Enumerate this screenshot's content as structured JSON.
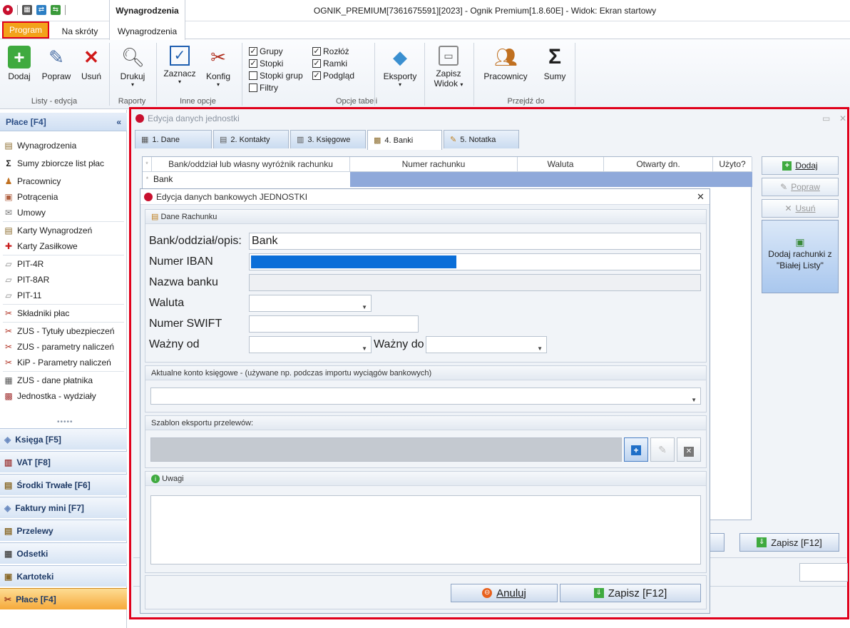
{
  "window": {
    "title": "OGNIK_PREMIUM[7361675591][2023] - Ognik Premium[1.8.60E] - Widok: Ekran startowy",
    "context_tab": "Wynagrodzenia"
  },
  "tabs": {
    "program": "Program",
    "shortcuts": "Na skróty",
    "active": "Wynagrodzenia"
  },
  "ribbon": {
    "lists": {
      "add": "Dodaj",
      "edit": "Popraw",
      "delete": "Usuń",
      "group": "Listy - edycja"
    },
    "reports": {
      "print": "Drukuj",
      "group": "Raporty"
    },
    "other": {
      "select": "Zaznacz",
      "config": "Konfig",
      "group": "Inne opcje"
    },
    "options": {
      "items": [
        {
          "label": "Grupy",
          "checked": true
        },
        {
          "label": "Stopki",
          "checked": true
        },
        {
          "label": "Stopki grup",
          "checked": false
        },
        {
          "label": "Filtry",
          "checked": false
        },
        {
          "label": "Rozłóż",
          "checked": true
        },
        {
          "label": "Ramki",
          "checked": true
        },
        {
          "label": "Podgląd",
          "checked": true
        }
      ],
      "group": "Opcje tabeli"
    },
    "export": {
      "exports": "Eksporty",
      "save_view_1": "Zapisz",
      "save_view_2": "Widok"
    },
    "goto": {
      "employees": "Pracownicy",
      "sums": "Sumy",
      "group": "Przejdź do"
    }
  },
  "sidebar": {
    "header": "Płace [F4]",
    "items": [
      {
        "label": "Wynagrodzenia"
      },
      {
        "label": "Sumy zbiorcze list płac"
      },
      {
        "label": "Pracownicy"
      },
      {
        "label": "Potrącenia"
      },
      {
        "label": "Umowy"
      },
      {
        "label": "Karty Wynagrodzeń"
      },
      {
        "label": "Karty Zasiłkowe"
      },
      {
        "label": "PIT-4R"
      },
      {
        "label": "PIT-8AR"
      },
      {
        "label": "PIT-11"
      },
      {
        "label": "Składniki płac"
      },
      {
        "label": "ZUS - Tytuły ubezpieczeń"
      },
      {
        "label": "ZUS - parametry naliczeń"
      },
      {
        "label": "KiP - Parametry naliczeń"
      },
      {
        "label": "ZUS - dane płatnika"
      },
      {
        "label": "Jednostka - wydziały"
      }
    ],
    "modules": [
      {
        "label": "Księga [F5]"
      },
      {
        "label": "VAT [F8]"
      },
      {
        "label": "Środki Trwałe [F6]"
      },
      {
        "label": "Faktury mini [F7]"
      },
      {
        "label": "Przelewy"
      },
      {
        "label": "Odsetki"
      },
      {
        "label": "Kartoteki"
      },
      {
        "label": "Płace [F4]"
      }
    ]
  },
  "unit_window": {
    "title": "Edycja danych jednostki",
    "tabs": [
      "1. Dane",
      "2. Kontakty",
      "3. Księgowe",
      "4. Banki",
      "5. Notatka"
    ],
    "grid": {
      "columns": [
        "Bank/oddział lub własny wyróżnik rachunku",
        "Numer rachunku",
        "Waluta",
        "Otwarty dn.",
        "Użyto?"
      ],
      "row": "Bank"
    },
    "buttons": {
      "add": "Dodaj",
      "edit": "Popraw",
      "delete": "Usuń",
      "white_list": "Dodaj rachunki z \"Białej Listy\"",
      "save": "Zapisz [F12]"
    }
  },
  "bank_dialog": {
    "title": "Edycja danych bankowych JEDNOSTKI",
    "section_account": "Dane Rachunku",
    "labels": {
      "bank": "Bank/oddział/opis:",
      "iban": "Numer IBAN",
      "bank_name": "Nazwa banku",
      "currency": "Waluta",
      "swift": "Numer SWIFT",
      "valid_from": "Ważny od",
      "valid_to": "Ważny do"
    },
    "values": {
      "bank": "Bank",
      "iban": "",
      "bank_name": "",
      "currency": "",
      "swift": "",
      "valid_from": "",
      "valid_to": ""
    },
    "section_ledger": "Aktualne konto księgowe - (używane np. podczas importu wyciągów bankowych)",
    "section_template": "Szablon eksportu przelewów:",
    "section_notes": "Uwagi",
    "cancel": "Anuluj",
    "save": "Zapisz [F12]"
  }
}
